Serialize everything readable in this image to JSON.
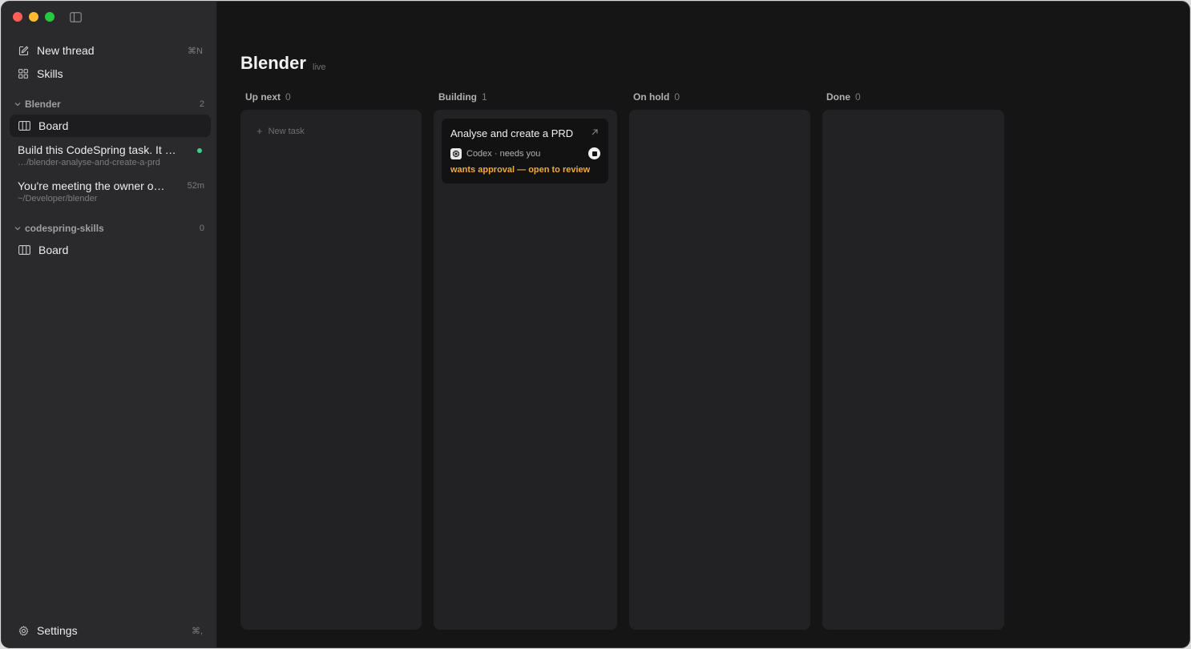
{
  "sidebar": {
    "new_thread": {
      "label": "New thread",
      "shortcut": "⌘N"
    },
    "skills": {
      "label": "Skills"
    },
    "groups": [
      {
        "name": "Blender",
        "count": "2",
        "board_label": "Board",
        "threads": [
          {
            "title": "Build this CodeSpring task. It is the first task",
            "path": "…/blender-analyse-and-create-a-prd",
            "status": "running"
          },
          {
            "title": "You're meeting the owner of this project",
            "path": "~/Developer/blender",
            "time": "52m"
          }
        ]
      },
      {
        "name": "codespring-skills",
        "count": "0",
        "board_label": "Board"
      }
    ],
    "settings": {
      "label": "Settings",
      "shortcut": "⌘,"
    }
  },
  "main": {
    "title": "Blender",
    "badge": "live",
    "columns": [
      {
        "name": "Up next",
        "count": "0",
        "new_task_label": "New task"
      },
      {
        "name": "Building",
        "count": "1"
      },
      {
        "name": "On hold",
        "count": "0"
      },
      {
        "name": "Done",
        "count": "0"
      }
    ],
    "card": {
      "title": "Analyse and create a PRD",
      "agent": "Codex · needs you",
      "status": "wants approval — open to review"
    }
  },
  "colors": {
    "accent_warning": "#f0a93c",
    "status_running": "#3fcf8e"
  }
}
